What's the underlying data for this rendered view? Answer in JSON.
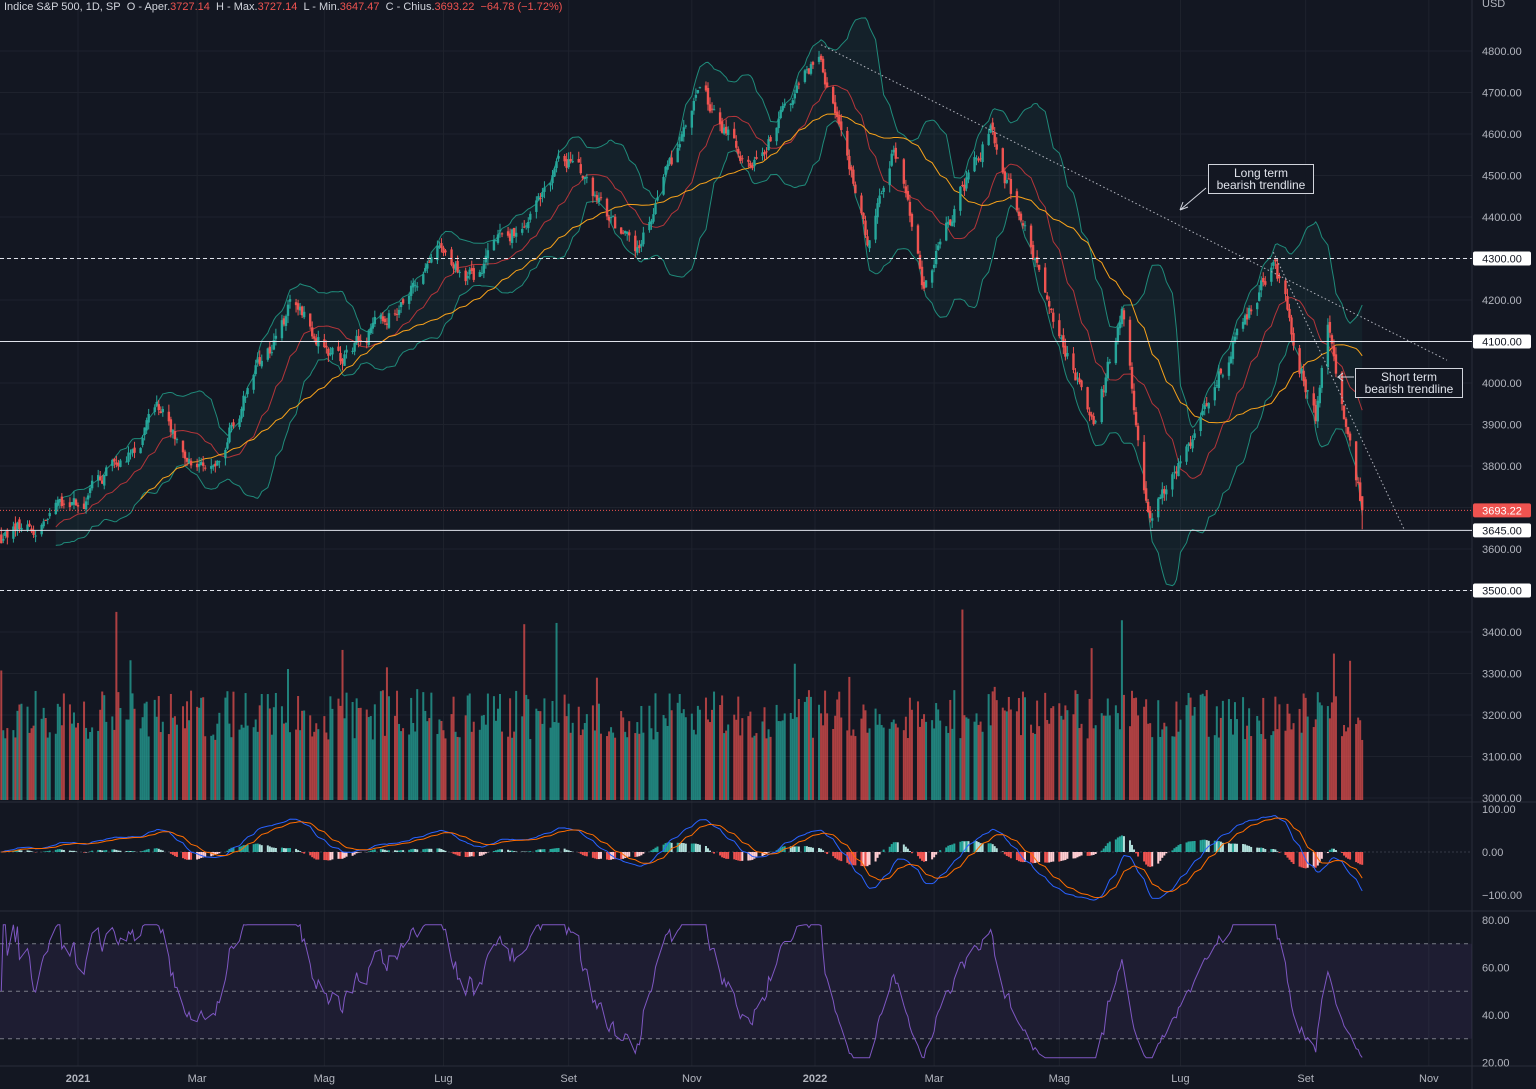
{
  "header": {
    "symbol": "Indice S&P 500, 1D, SP",
    "open_label": "O - Aper.",
    "open": "3727.14",
    "high_label": "H - Max.",
    "high": "3727.14",
    "low_label": "L - Min.",
    "low": "3647.47",
    "close_label": "C - Chius.",
    "close": "3693.22",
    "change": "−64.78 (−1.72%)"
  },
  "currency": "USD",
  "annotations": {
    "long": [
      "Long term",
      "bearish trendline"
    ],
    "short": [
      "Short term",
      "bearish trendline"
    ]
  },
  "colors": {
    "up": "#26a69a",
    "down": "#ef5350",
    "sma20": "#b2353a",
    "sma50": "#f7a21b",
    "bb": "#1f8a7a",
    "macd": "#2962ff",
    "signal": "#ff6d00",
    "rsi": "#7e57c2",
    "bg": "#131722"
  },
  "chart_data": {
    "type": "candlestick",
    "title": "Indice S&P 500, 1D, SP",
    "price_axis": {
      "ticks": [
        "4800.00",
        "4700.00",
        "4600.00",
        "4500.00",
        "4400.00",
        "4300.00",
        "4200.00",
        "4100.00",
        "4000.00",
        "3900.00",
        "3800.00",
        "3700.00",
        "3600.00",
        "3500.00",
        "3400.00",
        "3300.00",
        "3200.00",
        "3100.00",
        "3000.00"
      ],
      "range": [
        3000,
        4870
      ]
    },
    "price_tags": [
      {
        "value": "4300.00",
        "price": 4300,
        "style": "dashed"
      },
      {
        "value": "4100.00",
        "price": 4100,
        "style": "solid"
      },
      {
        "value": "3693.22",
        "price": 3693.22,
        "style": "last"
      },
      {
        "value": "3645.00",
        "price": 3645,
        "style": "solid"
      },
      {
        "value": "3500.00",
        "price": 3500,
        "style": "dashed"
      }
    ],
    "time_axis": [
      {
        "label": "2021",
        "date": "2021-01-01",
        "bold": true
      },
      {
        "label": "Mar",
        "date": "2021-03-01"
      },
      {
        "label": "Mag",
        "date": "2021-05-03"
      },
      {
        "label": "Lug",
        "date": "2021-07-01"
      },
      {
        "label": "Set",
        "date": "2021-09-01"
      },
      {
        "label": "Nov",
        "date": "2021-11-01"
      },
      {
        "label": "2022",
        "date": "2022-01-01",
        "bold": true
      },
      {
        "label": "Mar",
        "date": "2022-03-01"
      },
      {
        "label": "Mag",
        "date": "2022-05-02"
      },
      {
        "label": "Lug",
        "date": "2022-07-01"
      },
      {
        "label": "Set",
        "date": "2022-09-01"
      },
      {
        "label": "Nov",
        "date": "2022-11-01"
      }
    ],
    "close_keypoints": [
      [
        "2020-11-24",
        3630
      ],
      [
        "2021-01-04",
        3720
      ],
      [
        "2021-02-12",
        3930
      ],
      [
        "2021-03-04",
        3770
      ],
      [
        "2021-04-16",
        4180
      ],
      [
        "2021-05-12",
        4060
      ],
      [
        "2021-06-29",
        4300
      ],
      [
        "2021-07-19",
        4260
      ],
      [
        "2021-09-02",
        4540
      ],
      [
        "2021-10-04",
        4300
      ],
      [
        "2021-11-05",
        4700
      ],
      [
        "2021-12-01",
        4510
      ],
      [
        "2022-01-03",
        4800
      ],
      [
        "2022-01-27",
        4330
      ],
      [
        "2022-02-09",
        4590
      ],
      [
        "2022-02-24",
        4230
      ],
      [
        "2022-03-29",
        4630
      ],
      [
        "2022-04-12",
        4400
      ],
      [
        "2022-05-20",
        3900
      ],
      [
        "2022-06-02",
        4170
      ],
      [
        "2022-06-16",
        3670
      ],
      [
        "2022-07-01",
        3820
      ],
      [
        "2022-08-16",
        4300
      ],
      [
        "2022-09-06",
        3910
      ],
      [
        "2022-09-12",
        4110
      ],
      [
        "2022-09-29",
        3693
      ]
    ],
    "trendlines": [
      {
        "name": "long-term-bearish",
        "from": [
          "2022-01-04",
          4815
        ],
        "to": [
          "2022-11-10",
          4055
        ]
      },
      {
        "name": "short-term-bearish",
        "from": [
          "2022-08-16",
          4315
        ],
        "to": [
          "2022-10-20",
          3645
        ]
      }
    ],
    "indicators": {
      "overlays": [
        "SMA 20",
        "SMA 50",
        "Bollinger Bands 20 2"
      ],
      "volume": true,
      "macd": {
        "ticks": [
          "100.00",
          "0.00",
          "−100.00"
        ]
      },
      "rsi": {
        "ticks": [
          "80.00",
          "60.00",
          "40.00",
          "20.00"
        ],
        "bands": [
          70,
          50,
          30
        ]
      }
    }
  }
}
